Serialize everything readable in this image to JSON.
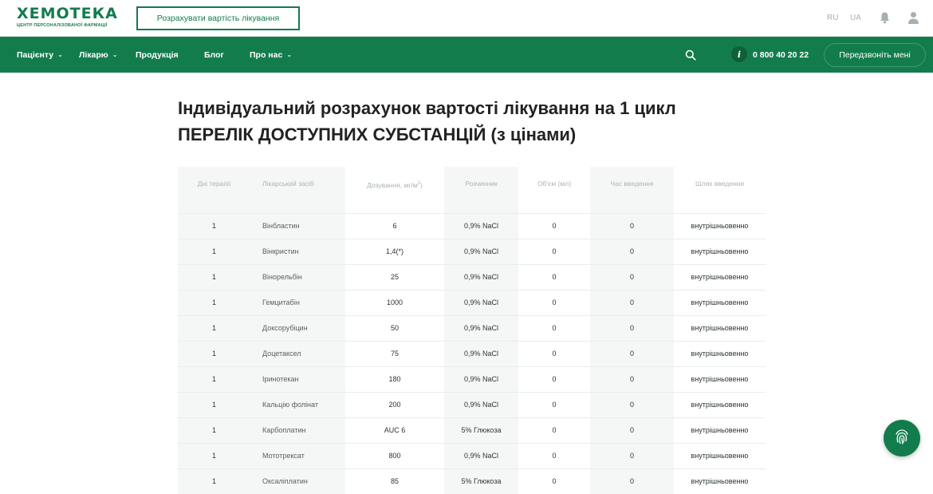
{
  "header": {
    "logo_text": "ХЕМОТЕКА",
    "logo_subtitle": "ЦЕНТР ПЕРСОНАЛІЗОВАНОЇ ФАРМАЦІЇ",
    "calc_button": "Розрахувати вартість лікування",
    "lang_ru": "RU",
    "lang_ua": "UA",
    "icons": [
      "bell-icon",
      "user-icon"
    ]
  },
  "nav": {
    "items": [
      {
        "label": "Пацієнту",
        "has_dropdown": true
      },
      {
        "label": "Лікарю",
        "has_dropdown": true
      },
      {
        "label": "Продукція",
        "has_dropdown": false
      },
      {
        "label": "Блог",
        "has_dropdown": false
      },
      {
        "label": "Про нас",
        "has_dropdown": true
      }
    ],
    "phone": "0 800 40 20 22",
    "info_glyph": "i",
    "callback_button": "Передзвоніть мені"
  },
  "page": {
    "title_line1": "Індивідуальний розрахунок вартості лікування на 1 цикл",
    "title_line2": "ПЕРЕЛІК ДОСТУПНИХ СУБСТАНЦІЙ (з цінами)"
  },
  "table": {
    "headers": [
      "Дні терапії",
      "Лікарський засіб",
      "Дозування, мг/м",
      "Розчинник",
      "Об'єм (мл)",
      "Час введення",
      "Шлях введення"
    ],
    "rows": [
      [
        "1",
        "Вінбластин",
        "6",
        "0,9% NaCl",
        "0",
        "0",
        "внутрішньовенно"
      ],
      [
        "1",
        "Вінкристин",
        "1,4(*)",
        "0,9% NaCl",
        "0",
        "0",
        "внутрішньовенно"
      ],
      [
        "1",
        "Вінорельбін",
        "25",
        "0,9% NaCl",
        "0",
        "0",
        "внутрішньовенно"
      ],
      [
        "1",
        "Гемцитабін",
        "1000",
        "0,9% NaCl",
        "0",
        "0",
        "внутрішньовенно"
      ],
      [
        "1",
        "Доксорубіцин",
        "50",
        "0,9% NaCl",
        "0",
        "0",
        "внутрішньовенно"
      ],
      [
        "1",
        "Доцетаксел",
        "75",
        "0,9% NaCl",
        "0",
        "0",
        "внутрішньовенно"
      ],
      [
        "1",
        "Іринотекан",
        "180",
        "0,9% NaCl",
        "0",
        "0",
        "внутрішньовенно"
      ],
      [
        "1",
        "Кальцію фолінат",
        "200",
        "0,9% NaCl",
        "0",
        "0",
        "внутрішньовенно"
      ],
      [
        "1",
        "Карбоплатин",
        "AUC 6",
        "5% Глюкоза",
        "0",
        "0",
        "внутрішньовенно"
      ],
      [
        "1",
        "Мототрексат",
        "800",
        "0,9% NaCl",
        "0",
        "0",
        "внутрішньовенно"
      ],
      [
        "1",
        "Оксаліплатин",
        "85",
        "5% Глюкоза",
        "0",
        "0",
        "внутрішньовенно"
      ]
    ]
  },
  "fab": {
    "icon": "fingerprint-icon"
  },
  "colors": {
    "brand_green": "#137c4d",
    "header_text": "#a9b3b3"
  }
}
